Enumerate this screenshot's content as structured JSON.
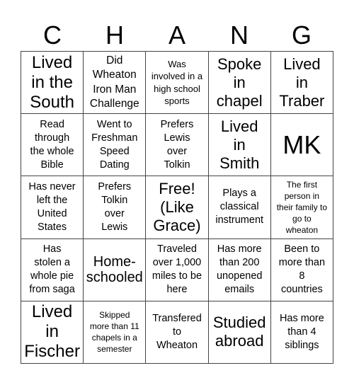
{
  "header": {
    "letters": [
      "C",
      "H",
      "A",
      "N",
      "G"
    ]
  },
  "board": {
    "rows": [
      [
        "Lived\nin the\nSouth",
        "Did\nWheaton\nIron Man\nChallenge",
        "Was\ninvolved in a\nhigh school\nsports",
        "Spoke\nin\nchapel",
        "Lived\nin\nTraber"
      ],
      [
        "Read\nthrough\nthe whole\nBible",
        "Went to\nFreshman\nSpeed\nDating",
        "Prefers\nLewis\nover\nTolkin",
        "Lived\nin\nSmith",
        "MK"
      ],
      [
        "Has never\nleft the\nUnited\nStates",
        "Prefers\nTolkin\nover\nLewis",
        "Free!\n(Like\nGrace)",
        "Plays a\nclassical\ninstrument",
        "The first\nperson in\ntheir family to\ngo to\nwheaton"
      ],
      [
        "Has\nstolen a\nwhole pie\nfrom saga",
        "Home-\nschooled",
        "Traveled\nover 1,000\nmiles to be\nhere",
        "Has more\nthan 200\nunopened\nemails",
        "Been to\nmore than\n8\ncountries"
      ],
      [
        "Lived\nin\nFischer",
        "Skipped\nmore than 11\nchapels in a\nsemester",
        "Transfered\nto\nWheaton",
        "Studied\nabroad",
        "Has more\nthan 4\nsiblings"
      ]
    ]
  }
}
